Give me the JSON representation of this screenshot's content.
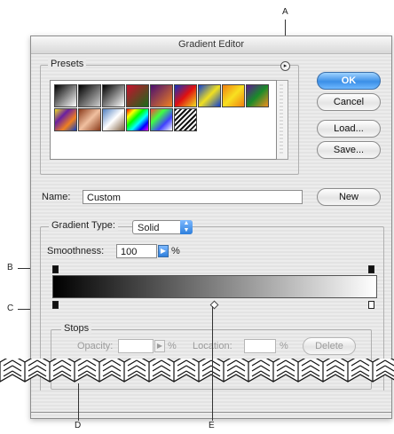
{
  "callouts": {
    "a": "A",
    "b": "B",
    "c": "C",
    "d": "D",
    "e": "E"
  },
  "dialog": {
    "title": "Gradient Editor"
  },
  "presets": {
    "label": "Presets",
    "menu_icon": "circle-arrow-icon",
    "swatches": [
      {
        "name": "foreground-to-background",
        "colors": [
          "#000000",
          "#ffffff"
        ]
      },
      {
        "name": "foreground-to-transparent",
        "colors": [
          "#000000",
          "#cfcfcf"
        ]
      },
      {
        "name": "black-white",
        "colors": [
          "#000000",
          "#ffffff"
        ]
      },
      {
        "name": "red-green",
        "colors": [
          "#c8102e",
          "#1a6b1a"
        ]
      },
      {
        "name": "violet-orange",
        "colors": [
          "#4a1070",
          "#f08020"
        ]
      },
      {
        "name": "blue-red-yellow",
        "colors": [
          "#1030c0",
          "#e01010",
          "#f0e020"
        ]
      },
      {
        "name": "blue-yellow-blue",
        "colors": [
          "#1040d0",
          "#f0e020",
          "#1040d0"
        ]
      },
      {
        "name": "orange-yellow-orange",
        "colors": [
          "#f08010",
          "#f8e020",
          "#f08010"
        ]
      },
      {
        "name": "violet-green-orange",
        "colors": [
          "#5a1a90",
          "#1a8a2a",
          "#f09020"
        ]
      },
      {
        "name": "yellow-violet-orange-blue",
        "colors": [
          "#f0e020",
          "#6a20a0",
          "#f08020",
          "#1040c0"
        ]
      },
      {
        "name": "copper",
        "colors": [
          "#8a3a1a",
          "#f0c0a0",
          "#8a3a1a"
        ]
      },
      {
        "name": "chrome",
        "colors": [
          "#5080c0",
          "#ffffff",
          "#806040"
        ]
      },
      {
        "name": "spectrum",
        "colors": [
          "#ff0000",
          "#ffff00",
          "#00ff00",
          "#00ffff",
          "#0000ff",
          "#ff00ff"
        ]
      },
      {
        "name": "transparent-rainbow",
        "colors": [
          "#ff4040",
          "#40ff40",
          "#4040ff",
          "#ffffff"
        ]
      },
      {
        "name": "transparent-stripes",
        "colors": [
          "#ffffff",
          "#000000"
        ]
      }
    ]
  },
  "buttons": {
    "ok": "OK",
    "cancel": "Cancel",
    "load": "Load...",
    "save": "Save...",
    "new": "New"
  },
  "name_field": {
    "label": "Name:",
    "value": "Custom"
  },
  "gradient": {
    "group_label": "",
    "type_label": "Gradient Type:",
    "type_value": "Solid",
    "smoothness_label": "Smoothness:",
    "smoothness_value": "100",
    "smoothness_unit": "%",
    "start_color": "#000000",
    "end_color": "#ffffff"
  },
  "stops": {
    "label": "Stops",
    "opacity_label": "Opacity:",
    "opacity_unit": "%",
    "location_label": "Location:",
    "location_unit": "%",
    "delete_label": "Delete"
  }
}
